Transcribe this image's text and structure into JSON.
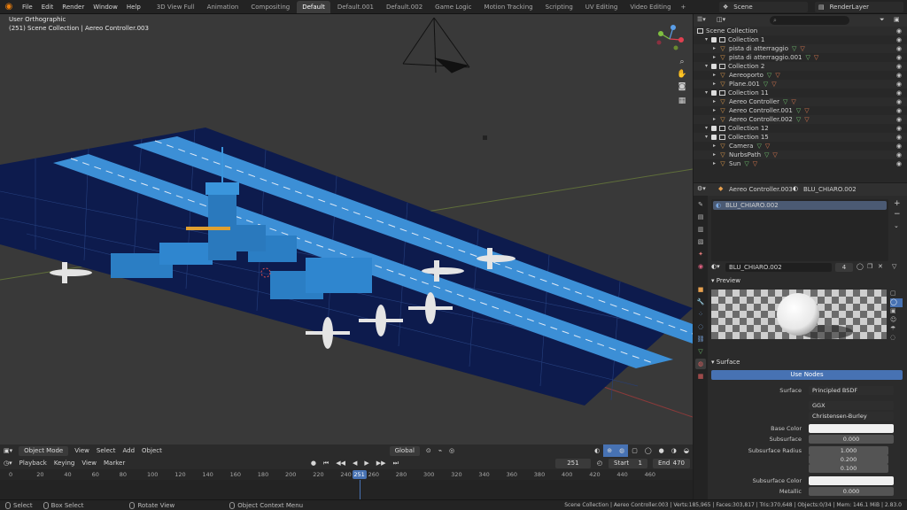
{
  "menubar": {
    "items": [
      "File",
      "Edit",
      "Render",
      "Window",
      "Help"
    ],
    "workspaces": [
      "3D View Full",
      "Animation",
      "Compositing",
      "Default",
      "Default.001",
      "Default.002",
      "Game Logic",
      "Motion Tracking",
      "Scripting",
      "UV Editing",
      "Video Editing"
    ],
    "active_workspace": "Default",
    "scene": "Scene",
    "render_layer": "RenderLayer"
  },
  "viewport": {
    "view_name": "User Orthographic",
    "collection_info": "(251) Scene Collection | Aereo Controller.003"
  },
  "viewport_header": {
    "mode": "Object Mode",
    "menus": [
      "View",
      "Select",
      "Add",
      "Object"
    ],
    "orientation": "Global"
  },
  "timeline": {
    "menus": [
      "Playback",
      "Keying",
      "View",
      "Marker"
    ],
    "current_frame": "251",
    "start_label": "Start",
    "start": "1",
    "end_label": "End",
    "end": "470",
    "ticks": [
      "0",
      "20",
      "40",
      "60",
      "80",
      "100",
      "120",
      "140",
      "160",
      "180",
      "200",
      "220",
      "240",
      "260",
      "280",
      "300",
      "320",
      "340",
      "360",
      "380",
      "400",
      "420",
      "440",
      "460"
    ]
  },
  "statusbar": {
    "select": "Select",
    "box_select": "Box Select",
    "rotate_view": "Rotate View",
    "context_menu": "Object Context Menu",
    "stats": "Scene Collection | Aereo Controller.003 | Verts:185,965 | Faces:303,817 | Tris:370,648 | Objects:0/34 | Mem: 146.1 MiB | 2.83.0"
  },
  "outliner": {
    "root": "Scene Collection",
    "rows": [
      {
        "label": "Collection 1",
        "kind": "collection",
        "indent": 1
      },
      {
        "label": "pista di atterraggio",
        "kind": "object",
        "indent": 2
      },
      {
        "label": "pista di atterraggio.001",
        "kind": "object",
        "indent": 2
      },
      {
        "label": "Collection 2",
        "kind": "collection",
        "indent": 1
      },
      {
        "label": "Aereoporto",
        "kind": "object",
        "indent": 2
      },
      {
        "label": "Plane.001",
        "kind": "object",
        "indent": 2
      },
      {
        "label": "Collection 11",
        "kind": "collection",
        "indent": 1
      },
      {
        "label": "Aereo Controller",
        "kind": "object",
        "indent": 2
      },
      {
        "label": "Aereo Controller.001",
        "kind": "object",
        "indent": 2
      },
      {
        "label": "Aereo Controller.002",
        "kind": "object",
        "indent": 2
      },
      {
        "label": "Collection 12",
        "kind": "collection",
        "indent": 1
      },
      {
        "label": "Collection 15",
        "kind": "collection",
        "indent": 1
      },
      {
        "label": "Camera",
        "kind": "object",
        "indent": 2
      },
      {
        "label": "NurbsPath",
        "kind": "object",
        "indent": 2
      },
      {
        "label": "Sun",
        "kind": "object",
        "indent": 2
      }
    ]
  },
  "properties": {
    "object_name": "Aereo Controller.003",
    "material_name": "BLU_CHIARO.002",
    "slot_name": "BLU_CHIARO.002",
    "material_field": "BLU_CHIARO.002",
    "user_count": "4",
    "preview_label": "Preview",
    "surface_label": "Surface",
    "use_nodes": "Use Nodes",
    "surface": {
      "label": "Surface",
      "value": "Principled BSDF"
    },
    "distribution": "GGX",
    "subsurface_method": "Christensen-Burley",
    "base_color_label": "Base Color",
    "subsurface": {
      "label": "Subsurface",
      "value": "0.000"
    },
    "subsurface_radius": {
      "label": "Subsurface Radius",
      "values": [
        "1.000",
        "0.200",
        "0.100"
      ]
    },
    "subsurface_color_label": "Subsurface Color",
    "metallic": {
      "label": "Metallic",
      "value": "0.000"
    }
  },
  "colors": {
    "accent": "#4772b3",
    "runway": "#3c8fd6",
    "apron": "#0d1b4d",
    "building": "#2b7ec4"
  }
}
